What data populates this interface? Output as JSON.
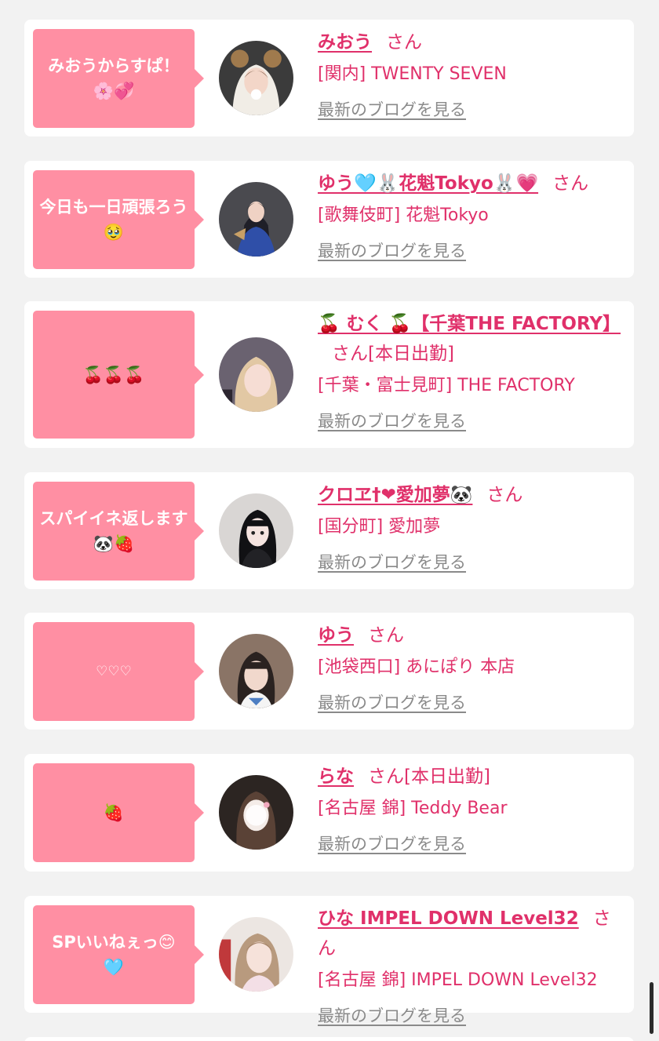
{
  "colors": {
    "page_bg": "#f2f2f2",
    "card_bg": "#ffffff",
    "bubble_bg": "#ff8fa3",
    "accent": "#e0306a",
    "blog_link": "#8a8a8a"
  },
  "blog_link_label": "最新のブログを見る",
  "entries": [
    {
      "comment": "みおうからすぱ！\n🌸💞",
      "name": "みおう",
      "san": "さん",
      "status": "",
      "shop": "[関内] TWENTY SEVEN",
      "avatar": "avatar-photo"
    },
    {
      "comment": "今日も一日頑張ろう🥹",
      "name": "ゆう🩵🐰花魁Tokyo🐰💗",
      "san": "さん",
      "status": "",
      "shop": "[歌舞伎町] 花魁Tokyo",
      "avatar": "avatar-photo"
    },
    {
      "comment": "🍒🍒🍒",
      "name": "🍒 むく 🍒【千葉THE FACTORY】",
      "san": "さん",
      "status": "[本日出勤]",
      "shop": "[千葉・富士見町] THE FACTORY",
      "avatar": "avatar-photo"
    },
    {
      "comment": "スパイイネ返します🐼🍓",
      "name": "クロヱ†❤愛加夢🐼",
      "san": "さん",
      "status": "",
      "shop": "[国分町] 愛加夢",
      "avatar": "avatar-photo"
    },
    {
      "comment": "♡♡♡",
      "name": "ゆう",
      "san": "さん",
      "status": "",
      "shop": "[池袋西口] あにぽり 本店",
      "avatar": "avatar-photo"
    },
    {
      "comment": "🍓",
      "name": "らな",
      "san": "さん",
      "status": "[本日出勤]",
      "shop": "[名古屋 錦] Teddy Bear",
      "avatar": "avatar-photo"
    },
    {
      "comment": "SPいいねぇっ😊\n🩵",
      "name": "ひな IMPEL DOWN Level32",
      "san": "さん",
      "status": "",
      "shop": "[名古屋 錦] IMPEL DOWN Level32",
      "avatar": "avatar-photo"
    }
  ]
}
